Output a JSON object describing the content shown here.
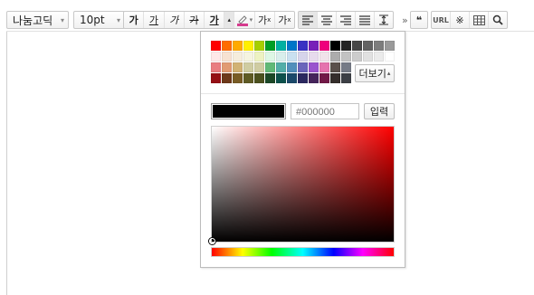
{
  "toolbar": {
    "font_family": "나눔고딕",
    "font_size": "10pt",
    "bold": "가",
    "underline": "가",
    "italic": "가",
    "strike": "가",
    "font_color": "가",
    "font_color_arrow": "▴",
    "bg_color_arrow": "▾",
    "superscript": "가",
    "superscript_mark": "x",
    "subscript": "가",
    "subscript_mark": "x",
    "overflow": "»",
    "quote": "❝",
    "url": "URL",
    "special_char": "※"
  },
  "colorpicker": {
    "more_label": "더보기",
    "more_arrow": "▴",
    "current_color": "#000000",
    "hex_placeholder": "#000000",
    "input_label": "입력",
    "palette": [
      [
        "#ff0000",
        "#ff6c00",
        "#ffaa00",
        "#ffef00",
        "#a6cf00",
        "#009e25",
        "#00b0a2",
        "#0075c8",
        "#3a32c3",
        "#7820b9",
        "#ef007c",
        "#000000",
        "#252525",
        "#464646",
        "#636363",
        "#7d7d7d",
        "#9a9a9a"
      ],
      [
        "#ffe8e8",
        "#f7e2d2",
        "#f5eddc",
        "#f5f4e0",
        "#edf2c2",
        "#def7e5",
        "#d9eeec",
        "#c9e0f0",
        "#d6d4eb",
        "#e7dbed",
        "#f1e2ea",
        "#acacac",
        "#c2c2c2",
        "#cccccc",
        "#e1e1e1",
        "#ebebeb",
        "#ffffff"
      ],
      [
        "#e97d81",
        "#e19b73",
        "#d1b274",
        "#cfcca2",
        "#cfcca2",
        "#61b977",
        "#53aea8",
        "#518fbb",
        "#6a65bb",
        "#9a54ce",
        "#e573ae",
        "#5a504b",
        "#767b86"
      ],
      [
        "#951015",
        "#6e391a",
        "#785c25",
        "#5f5b25",
        "#4c511f",
        "#1c4827",
        "#0d514c",
        "#1b496a",
        "#2b285f",
        "#45245b",
        "#721947",
        "#352e2c",
        "#3c3f45"
      ]
    ]
  }
}
